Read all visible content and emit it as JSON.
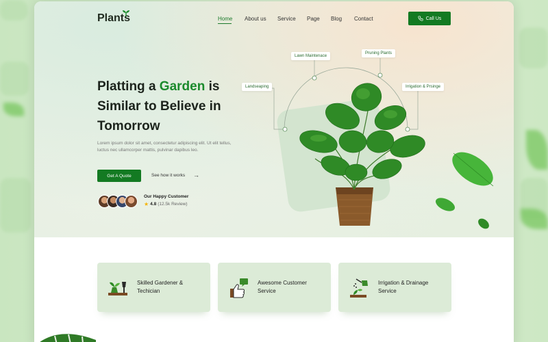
{
  "brand": {
    "logo": "Plants"
  },
  "nav": {
    "items": [
      {
        "label": "Home",
        "active": true
      },
      {
        "label": "About us"
      },
      {
        "label": "Service"
      },
      {
        "label": "Page"
      },
      {
        "label": "Blog"
      },
      {
        "label": "Contact"
      }
    ],
    "cta": "Call Us"
  },
  "hero": {
    "title_part1": "Platting a ",
    "title_highlight": "Garden",
    "title_part2": " is Similar to Believe in Tomorrow",
    "description": "Lorem ipsum dolor sit amet, consectetur adipiscing elit. Ut elit tellus, luctus nec ullamcorper mattis, pulvinar dapibus leo.",
    "primary_button": "Get A Quote",
    "secondary_link": "See how it works",
    "customers_label": "Our Happy Customer",
    "rating": "4.8",
    "reviews": "(12.5k Review)"
  },
  "plant_tags": {
    "landscaping": "Landseaping",
    "lawn": "Lawn Maintenace",
    "pruning": "Pruning Plants",
    "irrigation": "Irrigation & Prsinge"
  },
  "services": [
    {
      "title": "Skilled Gardener & Techician"
    },
    {
      "title": "Awesome Customer Service"
    },
    {
      "title": "Irrigation & Drainage Service"
    }
  ],
  "colors": {
    "brand_green": "#137a22",
    "highlight_green": "#1b8a2c",
    "star": "#f5b301"
  },
  "icons": {
    "call": "phone-icon",
    "arrow": "arrow-right-icon",
    "star": "star-icon"
  }
}
